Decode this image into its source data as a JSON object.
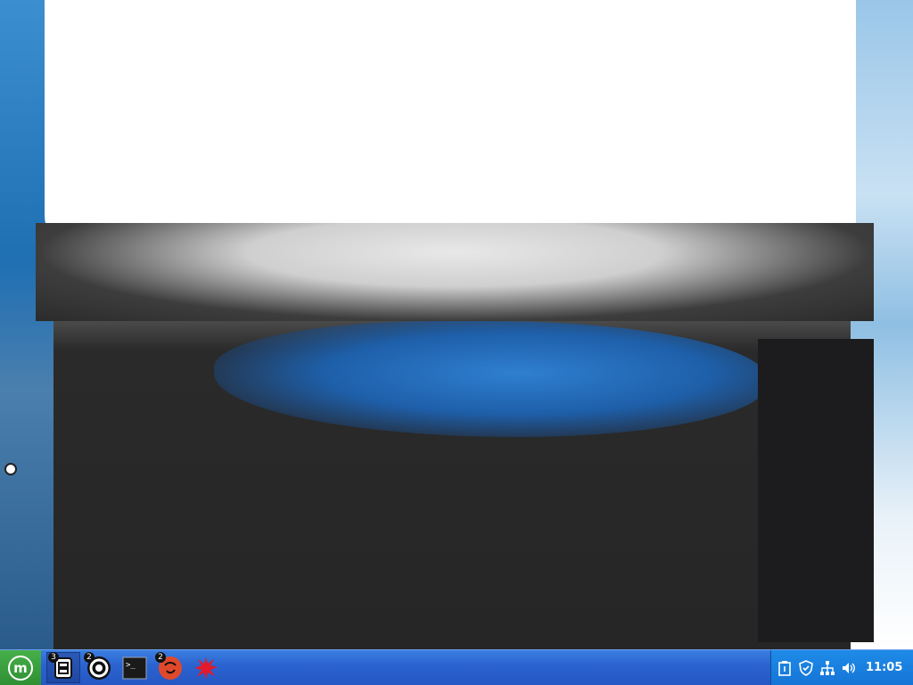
{
  "desktop": {
    "wallpaper": "abstract-clouds-over-blue-and-dark"
  },
  "taskbar": {
    "start_menu": {
      "icon": "linux-mint-logo-icon",
      "label": "m"
    },
    "tasks": [
      {
        "name": "file-manager",
        "icon": "file-manager-icon",
        "badge": "3",
        "active": true
      },
      {
        "name": "settings",
        "icon": "settings-icon",
        "badge": "2",
        "active": false
      },
      {
        "name": "terminal",
        "icon": "terminal-icon",
        "label": ">_",
        "active": false
      },
      {
        "name": "app-red",
        "icon": "red-circle-app-icon",
        "badge": "2",
        "active": false
      },
      {
        "name": "app-splat",
        "icon": "red-splat-app-icon",
        "active": false
      }
    ],
    "tray": {
      "icons": [
        "clipboard-icon",
        "shield-icon",
        "network-icon",
        "volume-icon"
      ],
      "clock": "11:05"
    }
  },
  "colors": {
    "taskbar": "#2a62cf",
    "tray": "#1575d6",
    "start": "#3a9a3d"
  }
}
